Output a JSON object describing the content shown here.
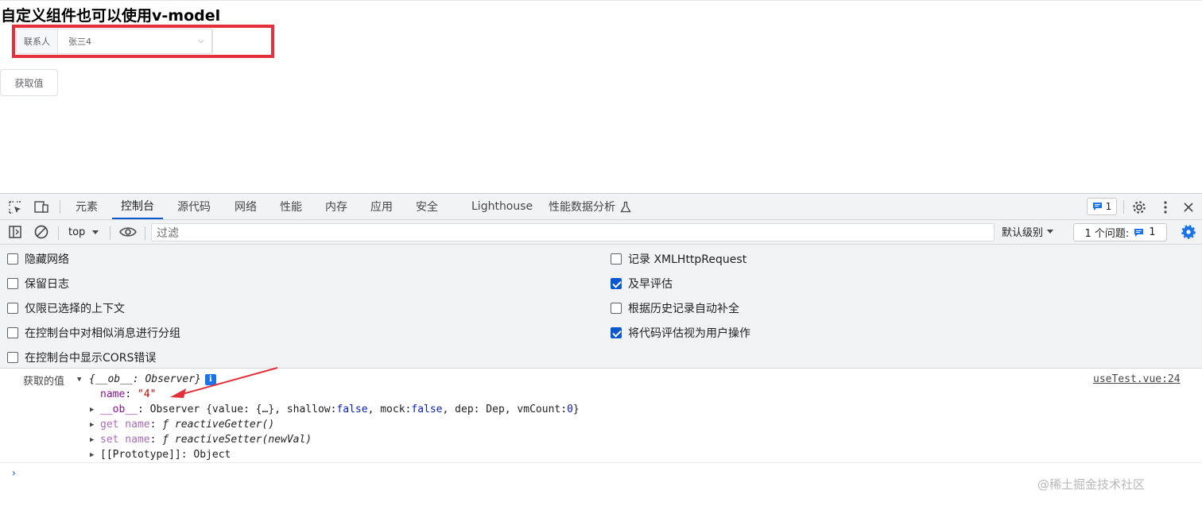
{
  "page": {
    "title": "自定义组件也可以使用v-model",
    "form": {
      "label": "联系人",
      "selected_value": "张三4"
    },
    "get_button_label": "获取值"
  },
  "devtools": {
    "tabs": [
      "元素",
      "控制台",
      "源代码",
      "网络",
      "性能",
      "内存",
      "应用",
      "安全",
      "Lighthouse",
      "性能数据分析"
    ],
    "active_tab": "控制台",
    "issue_count": "1",
    "toolbar": {
      "context": "top",
      "filter_placeholder": "过滤",
      "levels_label": "默认级别",
      "issues_label": "1 个问题:",
      "issues_count": "1"
    },
    "settings": {
      "left": [
        {
          "label": "隐藏网络",
          "checked": false
        },
        {
          "label": "保留日志",
          "checked": false
        },
        {
          "label": "仅限已选择的上下文",
          "checked": false
        },
        {
          "label": "在控制台中对相似消息进行分组",
          "checked": false
        },
        {
          "label": "在控制台中显示CORS错误",
          "checked": false
        }
      ],
      "right": [
        {
          "label": "记录 XMLHttpRequest",
          "checked": false
        },
        {
          "label": "及早评估",
          "checked": true
        },
        {
          "label": "根据历史记录自动补全",
          "checked": false
        },
        {
          "label": "将代码评估视为用户操作",
          "checked": true
        }
      ]
    },
    "console": {
      "log_prefix": "获取的值",
      "object_head": "{__ob__: Observer}",
      "source_link": "useTest.vue:24",
      "lines": {
        "name_key": "name",
        "name_value": "\"4\"",
        "ob_key": "__ob__",
        "ob_value_prefix": "Observer {value: {…}, shallow: ",
        "ob_shallow": "false",
        "ob_mid1": ", mock: ",
        "ob_mock": "false",
        "ob_mid2": ", dep: Dep, vmCount: ",
        "ob_vmcount": "0",
        "ob_close": "}",
        "getter_key": "get name",
        "getter_value": "ƒ reactiveGetter()",
        "setter_key": "set name",
        "setter_value": "ƒ reactiveSetter(newVal)",
        "proto_key": "[[Prototype]]",
        "proto_value": "Object"
      },
      "prompt": "›"
    }
  },
  "watermark": "@稀土掘金技术社区",
  "colors": {
    "highlight_box": "#e3303a",
    "accent": "#0b57d0"
  }
}
